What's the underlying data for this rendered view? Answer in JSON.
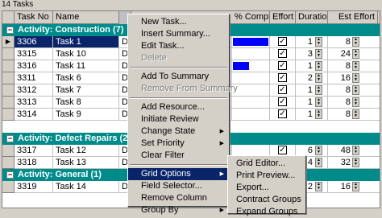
{
  "window": {
    "title": "14 Tasks"
  },
  "columns": [
    "Task No",
    "Name",
    "",
    "% Complet",
    "Effort I",
    "Duration",
    "Est Effort"
  ],
  "groups": [
    {
      "label": "Activity: Construction (7)"
    },
    {
      "label": "Activity: Defect Repairs (2"
    },
    {
      "label": "Activity: General (1)"
    }
  ],
  "rows": [
    {
      "id": "3306",
      "name": "Task 1",
      "desc": "De",
      "duration": "1",
      "est": "8"
    },
    {
      "id": "3315",
      "name": "Task 10",
      "desc": "De",
      "duration": "3",
      "est": "24"
    },
    {
      "id": "3316",
      "name": "Task 11",
      "desc": "De",
      "duration": "1",
      "est": "8"
    },
    {
      "id": "3311",
      "name": "Task 6",
      "desc": "De",
      "duration": "2",
      "est": "16"
    },
    {
      "id": "3312",
      "name": "Task 7",
      "desc": "De",
      "duration": "1",
      "est": "8"
    },
    {
      "id": "3313",
      "name": "Task 8",
      "desc": "De",
      "duration": "1",
      "est": "8"
    },
    {
      "id": "3314",
      "name": "Task 9",
      "desc": "De",
      "duration": "1",
      "est": "8"
    },
    {
      "id": "3317",
      "name": "Task 12",
      "desc": "De",
      "duration": "6",
      "est": "48"
    },
    {
      "id": "3318",
      "name": "Task 13",
      "desc": "De",
      "duration": "4",
      "est": "32"
    },
    {
      "id": "3319",
      "name": "Task 14",
      "desc": "De",
      "duration": "2",
      "est": "16"
    }
  ],
  "progress": {
    "row_3306": 1.0,
    "row_3316": 0.46
  },
  "context_menu": {
    "items": [
      {
        "label": "New Task...",
        "disabled": false
      },
      {
        "label": "Insert Summary...",
        "disabled": false
      },
      {
        "label": "Edit Task...",
        "disabled": false
      },
      {
        "label": "Delete",
        "disabled": true
      },
      {
        "label": "Add To Summary",
        "disabled": false
      },
      {
        "label": "Remove From Summary",
        "disabled": true
      },
      {
        "label": "Add Resource...",
        "disabled": false
      },
      {
        "label": "Initiate Review",
        "disabled": false
      },
      {
        "label": "Change State",
        "disabled": false
      },
      {
        "label": "Set Priority",
        "disabled": false
      },
      {
        "label": "Clear Filter",
        "disabled": false
      },
      {
        "label": "Grid Options",
        "disabled": false
      },
      {
        "label": "Field Selector...",
        "disabled": false
      },
      {
        "label": "Remove Column",
        "disabled": false
      },
      {
        "label": "Group By",
        "disabled": false
      }
    ]
  },
  "submenu": {
    "items": [
      {
        "label": "Grid Editor..."
      },
      {
        "label": "Print Preview..."
      },
      {
        "label": "Export..."
      },
      {
        "label": "Contract Groups"
      },
      {
        "label": "Expand Groups"
      }
    ]
  },
  "colors": {
    "group_bg": "#008b8b",
    "selection": "#0a246a",
    "progress_bar": "#0000ff",
    "chrome": "#d4d0c8"
  },
  "icons": {
    "row_pointer": "triangle-right",
    "checkbox": "check-mark",
    "submenu": "triangle-right",
    "spinner": "up-down-arrows"
  }
}
